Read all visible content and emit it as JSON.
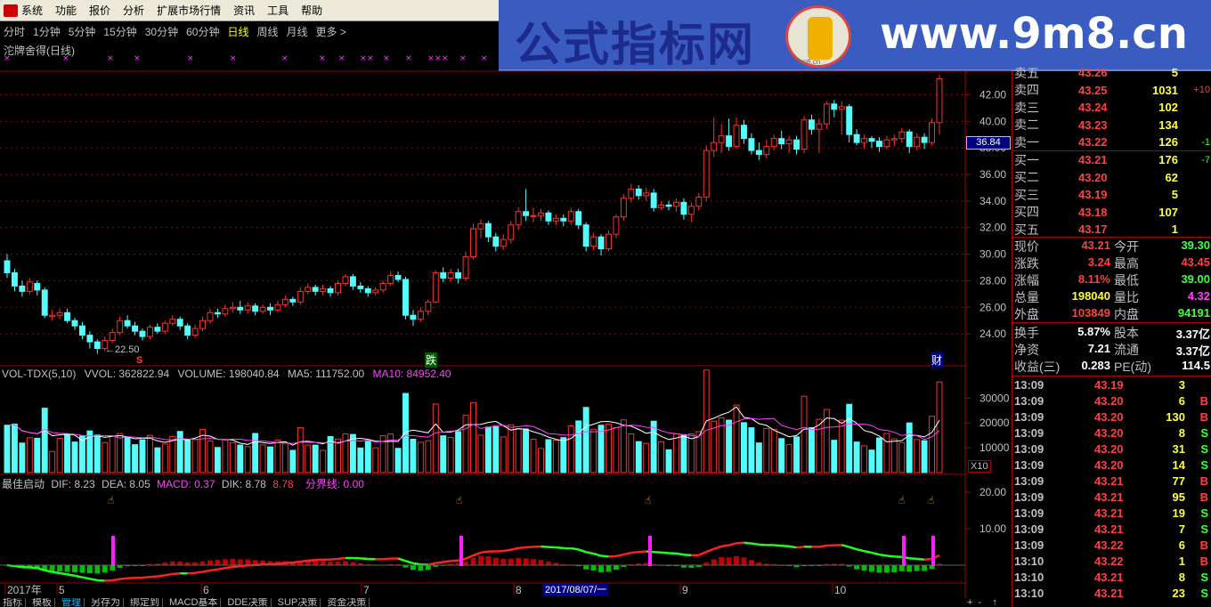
{
  "menu": {
    "items": [
      "系统",
      "功能",
      "报价",
      "分析",
      "扩展市场行情",
      "资讯",
      "工具",
      "帮助"
    ]
  },
  "periods": {
    "items": [
      "分时",
      "1分钟",
      "5分钟",
      "15分钟",
      "30分钟",
      "60分钟",
      "日线",
      "周线",
      "月线",
      "更多 >"
    ],
    "active": "日线"
  },
  "banner": {
    "left_text": "公式指标网",
    "right_text": "www.9m8.cn",
    "logo_small": "9m8.cn"
  },
  "main_indicator": {
    "name": "沱牌舍得(日线)",
    "markers": "× × × × ×"
  },
  "price_axis": {
    "ticks": [
      "42.00",
      "40.00",
      "38.00",
      "36.00",
      "34.00",
      "32.00",
      "30.00",
      "28.00",
      "26.00",
      "24.00"
    ],
    "current_box": "36.84"
  },
  "annotations": {
    "low_label": "←22.50",
    "s_mark": "S",
    "die_mark": "跌",
    "cai_mark": "财"
  },
  "vol_panel": {
    "title": "VOL-TDX(5,10)",
    "vvol": "VVOL: 362822.94",
    "volume": "VOLUME: 198040.84",
    "ma5": "MA5: 111752.00",
    "ma10": "MA10: 84952.40",
    "ticks": [
      "30000",
      "20000",
      "10000"
    ],
    "unit": "X10"
  },
  "macd_panel": {
    "title": "最佳启动",
    "dif": "DIF: 8.23",
    "dea": "DEA: 8.05",
    "macd": "MACD: 0.37",
    "dik": "DIK: 8.78",
    "dik2": "8.78",
    "fenjie": "分界线: 0.00",
    "ticks": [
      "20.00",
      "10.00"
    ]
  },
  "date_axis": {
    "labels": [
      "2017年",
      "5",
      "6",
      "7",
      "8",
      "9",
      "10"
    ],
    "highlight": "2017/08/07/一"
  },
  "quote": {
    "asks": [
      {
        "label": "卖五",
        "price": "43.26",
        "vol": "5",
        "chg": ""
      },
      {
        "label": "卖四",
        "price": "43.25",
        "vol": "1031",
        "chg": "+10"
      },
      {
        "label": "卖三",
        "price": "43.24",
        "vol": "102",
        "chg": ""
      },
      {
        "label": "卖二",
        "price": "43.23",
        "vol": "134",
        "chg": ""
      },
      {
        "label": "卖一",
        "price": "43.22",
        "vol": "126",
        "chg": "-1"
      }
    ],
    "bids": [
      {
        "label": "买一",
        "price": "43.21",
        "vol": "176",
        "chg": "-7"
      },
      {
        "label": "买二",
        "price": "43.20",
        "vol": "62",
        "chg": ""
      },
      {
        "label": "买三",
        "price": "43.19",
        "vol": "5",
        "chg": ""
      },
      {
        "label": "买四",
        "price": "43.18",
        "vol": "107",
        "chg": ""
      },
      {
        "label": "买五",
        "price": "43.17",
        "vol": "1",
        "chg": ""
      }
    ],
    "stats": [
      {
        "l1": "现价",
        "v1": "43.21",
        "c1": "#ff4040",
        "l2": "今开",
        "v2": "39.30",
        "c2": "#40ff40"
      },
      {
        "l1": "涨跌",
        "v1": "3.24",
        "c1": "#ff4040",
        "l2": "最高",
        "v2": "43.45",
        "c2": "#ff4040"
      },
      {
        "l1": "涨幅",
        "v1": "8.11%",
        "c1": "#ff4040",
        "l2": "最低",
        "v2": "39.00",
        "c2": "#40ff40"
      },
      {
        "l1": "总量",
        "v1": "198040",
        "c1": "#ffff40",
        "l2": "量比",
        "v2": "4.32",
        "c2": "#ff40ff"
      },
      {
        "l1": "外盘",
        "v1": "103849",
        "c1": "#ff4040",
        "l2": "内盘",
        "v2": "94191",
        "c2": "#40ff40"
      }
    ],
    "stats2": [
      {
        "l1": "换手",
        "v1": "5.87%",
        "c1": "#ffffff",
        "l2": "股本",
        "v2": "3.37亿",
        "c2": "#ffffff"
      },
      {
        "l1": "净资",
        "v1": "7.21",
        "c1": "#ffffff",
        "l2": "流通",
        "v2": "3.37亿",
        "c2": "#ffffff"
      },
      {
        "l1": "收益(三)",
        "v1": "0.283",
        "c1": "#ffffff",
        "l2": "PE(动)",
        "v2": "114.5",
        "c2": "#ffffff"
      }
    ],
    "ticks": [
      {
        "t": "13:09",
        "p": "43.19",
        "v": "3",
        "bs": ""
      },
      {
        "t": "13:09",
        "p": "43.20",
        "v": "6",
        "bs": "B"
      },
      {
        "t": "13:09",
        "p": "43.20",
        "v": "130",
        "bs": "B"
      },
      {
        "t": "13:09",
        "p": "43.20",
        "v": "8",
        "bs": "S"
      },
      {
        "t": "13:09",
        "p": "43.20",
        "v": "31",
        "bs": "S"
      },
      {
        "t": "13:09",
        "p": "43.20",
        "v": "14",
        "bs": "S"
      },
      {
        "t": "13:09",
        "p": "43.21",
        "v": "77",
        "bs": "B"
      },
      {
        "t": "13:09",
        "p": "43.21",
        "v": "95",
        "bs": "B"
      },
      {
        "t": "13:09",
        "p": "43.21",
        "v": "19",
        "bs": "S"
      },
      {
        "t": "13:09",
        "p": "43.21",
        "v": "7",
        "bs": "S"
      },
      {
        "t": "13:09",
        "p": "43.22",
        "v": "6",
        "bs": "B"
      },
      {
        "t": "13:10",
        "p": "43.22",
        "v": "1",
        "bs": "B"
      },
      {
        "t": "13:10",
        "p": "43.21",
        "v": "8",
        "bs": "S"
      },
      {
        "t": "13:10",
        "p": "43.21",
        "v": "23",
        "bs": "S"
      }
    ]
  },
  "bottom_tabs": {
    "items": [
      "指标",
      "模板",
      "管理",
      "另存为",
      "绑定到",
      "MACD基本",
      "DDE决策",
      "SUP决策",
      "资金决策"
    ],
    "selected": "管理"
  },
  "colors": {
    "up": "#ff3030",
    "down": "#54fcfc",
    "grid": "#a00000",
    "ma5": "#ffffff",
    "ma10": "#ff40ff"
  },
  "chart_data": {
    "type": "candlestick",
    "ylim": [
      22,
      43.5
    ],
    "candles": [
      [
        29.5,
        28.6,
        30.0,
        28.2
      ],
      [
        28.6,
        27.6,
        28.9,
        27.2
      ],
      [
        27.6,
        27.2,
        28.0,
        26.8
      ],
      [
        27.2,
        27.9,
        28.2,
        27.0
      ],
      [
        27.8,
        27.3,
        28.0,
        26.9
      ],
      [
        27.3,
        25.4,
        27.5,
        25.2
      ],
      [
        25.3,
        25.4,
        25.8,
        25.0
      ],
      [
        25.4,
        25.6,
        25.9,
        25.1
      ],
      [
        25.6,
        25.0,
        25.9,
        24.8
      ],
      [
        25.0,
        24.6,
        25.2,
        24.3
      ],
      [
        24.6,
        23.9,
        24.9,
        23.6
      ],
      [
        23.9,
        23.4,
        24.2,
        22.9
      ],
      [
        23.4,
        22.9,
        23.6,
        22.5
      ],
      [
        22.9,
        23.5,
        23.8,
        22.7
      ],
      [
        23.5,
        24.1,
        24.4,
        23.3
      ],
      [
        24.1,
        25.0,
        25.3,
        23.9
      ],
      [
        25.0,
        24.6,
        25.4,
        24.4
      ],
      [
        24.6,
        24.2,
        24.9,
        23.9
      ],
      [
        24.2,
        23.8,
        24.4,
        23.5
      ],
      [
        23.8,
        24.5,
        24.7,
        23.6
      ],
      [
        24.5,
        24.2,
        24.8,
        24.0
      ],
      [
        24.2,
        24.8,
        25.0,
        24.0
      ],
      [
        24.8,
        25.1,
        25.4,
        24.6
      ],
      [
        25.1,
        24.6,
        25.3,
        24.3
      ],
      [
        24.6,
        23.9,
        24.8,
        23.6
      ],
      [
        23.9,
        24.4,
        24.7,
        23.7
      ],
      [
        24.4,
        25.0,
        25.3,
        24.2
      ],
      [
        25.0,
        25.6,
        25.9,
        24.8
      ],
      [
        25.6,
        25.5,
        25.9,
        25.2
      ],
      [
        25.5,
        25.9,
        26.2,
        25.3
      ],
      [
        25.9,
        26.0,
        26.4,
        25.6
      ],
      [
        26.0,
        25.8,
        26.5,
        25.5
      ],
      [
        25.8,
        26.1,
        26.4,
        25.5
      ],
      [
        26.1,
        25.7,
        26.3,
        25.4
      ],
      [
        25.7,
        26.0,
        26.2,
        25.5
      ],
      [
        26.0,
        25.8,
        26.3,
        25.4
      ],
      [
        25.8,
        26.2,
        26.5,
        25.6
      ],
      [
        26.2,
        26.6,
        26.9,
        26.0
      ],
      [
        26.6,
        26.4,
        26.8,
        26.1
      ],
      [
        26.4,
        27.2,
        27.5,
        26.2
      ],
      [
        27.2,
        27.5,
        27.8,
        27.0
      ],
      [
        27.5,
        27.2,
        27.7,
        26.9
      ],
      [
        27.2,
        27.4,
        27.7,
        26.9
      ],
      [
        27.4,
        27.1,
        27.6,
        26.8
      ],
      [
        27.1,
        27.8,
        28.0,
        26.9
      ],
      [
        27.8,
        28.3,
        28.5,
        27.6
      ],
      [
        28.3,
        27.6,
        28.5,
        27.3
      ],
      [
        27.6,
        27.4,
        27.9,
        27.1
      ],
      [
        27.4,
        27.1,
        27.6,
        26.8
      ],
      [
        27.1,
        27.3,
        27.5,
        26.9
      ],
      [
        27.3,
        27.8,
        28.0,
        27.1
      ],
      [
        27.8,
        28.4,
        28.7,
        27.6
      ],
      [
        28.4,
        28.1,
        28.7,
        27.9
      ],
      [
        28.1,
        25.4,
        28.3,
        25.1
      ],
      [
        25.4,
        25.1,
        25.8,
        24.6
      ],
      [
        25.1,
        25.7,
        26.0,
        24.9
      ],
      [
        25.7,
        26.4,
        26.6,
        25.4
      ],
      [
        26.4,
        28.6,
        28.8,
        26.3
      ],
      [
        28.6,
        28.2,
        29.0,
        27.9
      ],
      [
        28.2,
        28.6,
        28.9,
        27.9
      ],
      [
        28.6,
        28.2,
        28.9,
        27.8
      ],
      [
        28.2,
        29.8,
        30.2,
        28.0
      ],
      [
        29.8,
        31.9,
        32.3,
        29.6
      ],
      [
        31.9,
        32.3,
        32.6,
        31.2
      ],
      [
        32.3,
        31.3,
        32.5,
        30.9
      ],
      [
        31.3,
        30.6,
        31.6,
        30.2
      ],
      [
        30.6,
        31.1,
        31.5,
        30.3
      ],
      [
        31.1,
        32.2,
        32.5,
        30.8
      ],
      [
        32.2,
        33.2,
        33.5,
        31.8
      ],
      [
        33.2,
        32.9,
        34.9,
        32.5
      ],
      [
        32.9,
        32.9,
        33.5,
        32.4
      ],
      [
        32.9,
        33.1,
        33.4,
        32.5
      ],
      [
        33.1,
        32.5,
        33.3,
        32.2
      ],
      [
        32.5,
        32.7,
        33.0,
        32.2
      ],
      [
        32.7,
        32.5,
        33.0,
        32.1
      ],
      [
        32.5,
        33.2,
        33.5,
        32.2
      ],
      [
        33.2,
        32.2,
        33.4,
        31.9
      ],
      [
        32.2,
        30.6,
        32.4,
        30.2
      ],
      [
        30.6,
        31.3,
        31.6,
        30.3
      ],
      [
        31.3,
        30.4,
        31.5,
        29.9
      ],
      [
        30.4,
        31.5,
        31.8,
        30.2
      ],
      [
        31.5,
        32.8,
        33.0,
        31.2
      ],
      [
        32.8,
        34.2,
        34.5,
        32.5
      ],
      [
        34.2,
        34.9,
        35.3,
        33.9
      ],
      [
        34.9,
        34.4,
        35.2,
        34.1
      ],
      [
        34.4,
        34.6,
        35.0,
        34.0
      ],
      [
        34.6,
        33.5,
        34.9,
        33.2
      ],
      [
        33.5,
        33.7,
        34.0,
        33.3
      ],
      [
        33.7,
        33.6,
        34.0,
        33.3
      ],
      [
        33.6,
        33.9,
        34.2,
        33.2
      ],
      [
        33.9,
        33.0,
        34.2,
        32.6
      ],
      [
        33.0,
        33.6,
        33.9,
        32.4
      ],
      [
        33.6,
        34.3,
        34.6,
        33.3
      ],
      [
        34.3,
        37.8,
        38.2,
        34.0
      ],
      [
        37.8,
        38.4,
        40.3,
        37.3
      ],
      [
        38.4,
        38.9,
        39.8,
        37.6
      ],
      [
        38.9,
        38.1,
        40.2,
        37.8
      ],
      [
        38.1,
        39.7,
        40.3,
        37.9
      ],
      [
        39.7,
        38.7,
        40.1,
        38.3
      ],
      [
        38.7,
        37.8,
        39.1,
        37.5
      ],
      [
        37.8,
        37.5,
        38.4,
        37.1
      ],
      [
        37.5,
        38.1,
        38.6,
        37.2
      ],
      [
        38.1,
        38.7,
        39.0,
        37.8
      ],
      [
        38.7,
        38.3,
        39.3,
        37.9
      ],
      [
        38.3,
        38.6,
        38.9,
        37.6
      ],
      [
        38.6,
        37.9,
        38.9,
        37.5
      ],
      [
        37.9,
        40.1,
        40.4,
        37.6
      ],
      [
        40.1,
        39.4,
        40.5,
        39.0
      ],
      [
        39.4,
        39.8,
        40.2,
        37.6
      ],
      [
        39.8,
        41.3,
        41.5,
        39.4
      ],
      [
        41.3,
        40.9,
        41.6,
        40.3
      ],
      [
        40.9,
        41.1,
        41.5,
        39.0
      ],
      [
        41.1,
        39.0,
        41.3,
        38.4
      ],
      [
        39.0,
        38.4,
        39.4,
        38.2
      ],
      [
        38.4,
        38.7,
        39.0,
        37.9
      ],
      [
        38.7,
        38.5,
        38.9,
        38.0
      ],
      [
        38.5,
        38.1,
        38.8,
        37.7
      ],
      [
        38.1,
        38.6,
        38.9,
        37.9
      ],
      [
        38.6,
        38.7,
        39.0,
        38.1
      ],
      [
        38.7,
        39.2,
        39.5,
        38.4
      ],
      [
        39.2,
        38.1,
        39.4,
        37.6
      ],
      [
        38.1,
        38.8,
        39.1,
        37.8
      ],
      [
        38.8,
        38.4,
        39.1,
        37.9
      ],
      [
        38.4,
        39.9,
        40.2,
        38.2
      ],
      [
        39.9,
        43.2,
        43.5,
        39.0
      ]
    ]
  }
}
